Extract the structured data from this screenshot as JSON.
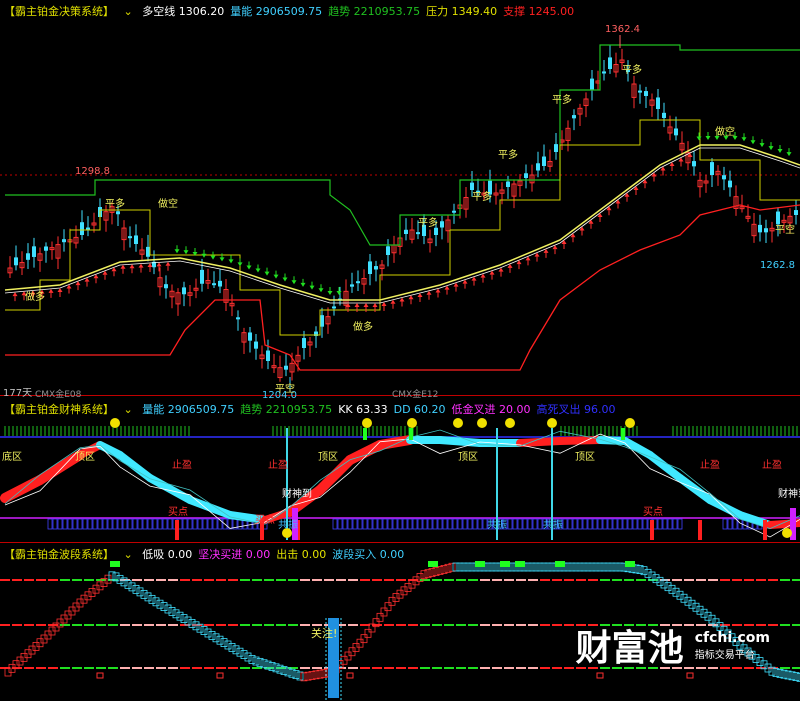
{
  "panels": {
    "p1": {
      "title": "【霸主铂金决策系统】",
      "items": [
        {
          "label": "多空线",
          "value": "1306.20",
          "color": "#ffffff"
        },
        {
          "label": "量能",
          "value": "2906509.75",
          "color": "#40d0ff"
        },
        {
          "label": "趋势",
          "value": "2210953.75",
          "color": "#20c020"
        },
        {
          "label": "压力",
          "value": "1349.40",
          "color": "#e0e000"
        },
        {
          "label": "支撑",
          "value": "1245.00",
          "color": "#ff2020"
        }
      ]
    },
    "p2": {
      "title": "【霸主铂金财神系统】",
      "items": [
        {
          "label": "量能",
          "value": "2906509.75",
          "color": "#40d0ff"
        },
        {
          "label": "趋势",
          "value": "2210953.75",
          "color": "#20c020"
        },
        {
          "label": "KK",
          "value": "63.33",
          "color": "#ffffff"
        },
        {
          "label": "DD",
          "value": "60.20",
          "color": "#40d0ff"
        },
        {
          "label": "低金叉进",
          "value": "20.00",
          "color": "#ff30ff"
        },
        {
          "label": "高死叉出",
          "value": "96.00",
          "color": "#3030ff"
        }
      ]
    },
    "p3": {
      "title": "【霸主铂金波段系统】",
      "items": [
        {
          "label": "低吸",
          "value": "0.00",
          "color": "#ffffff"
        },
        {
          "label": "坚决买进",
          "value": "0.00",
          "color": "#ff30ff"
        },
        {
          "label": "出击",
          "value": "0.00",
          "color": "#e0e000"
        },
        {
          "label": "波段买入",
          "value": "0.00",
          "color": "#40d0ff"
        }
      ]
    }
  },
  "chart_data": {
    "type": "candlestick",
    "price_annotations": [
      {
        "label": "1298.8",
        "color": "#ff6060"
      },
      {
        "label": "1362.4",
        "color": "#ff6060"
      },
      {
        "label": "1204.0",
        "color": "#40d0ff"
      },
      {
        "label": "1262.8",
        "color": "#40d0ff"
      }
    ],
    "period_labels": [
      "177天",
      "CMX金E08",
      "CMX金E12"
    ],
    "signals_main": [
      "做多",
      "平多",
      "做空",
      "平空",
      "做多",
      "平多",
      "平多",
      "平多",
      "平多",
      "平多",
      "做空",
      "平空"
    ],
    "signals_osc": [
      "底区",
      "顶区",
      "顶区",
      "顶区",
      "顶区",
      "财神到",
      "财神到",
      "买点",
      "买点",
      "买点",
      "共振",
      "共振",
      "共振",
      "止盈",
      "止盈",
      "止盈",
      "止盈"
    ],
    "signals_band": [
      "关注!"
    ]
  },
  "watermark": {
    "brand": "财富池",
    "url": "cfchi.com",
    "tagline": "指标交易平台"
  }
}
